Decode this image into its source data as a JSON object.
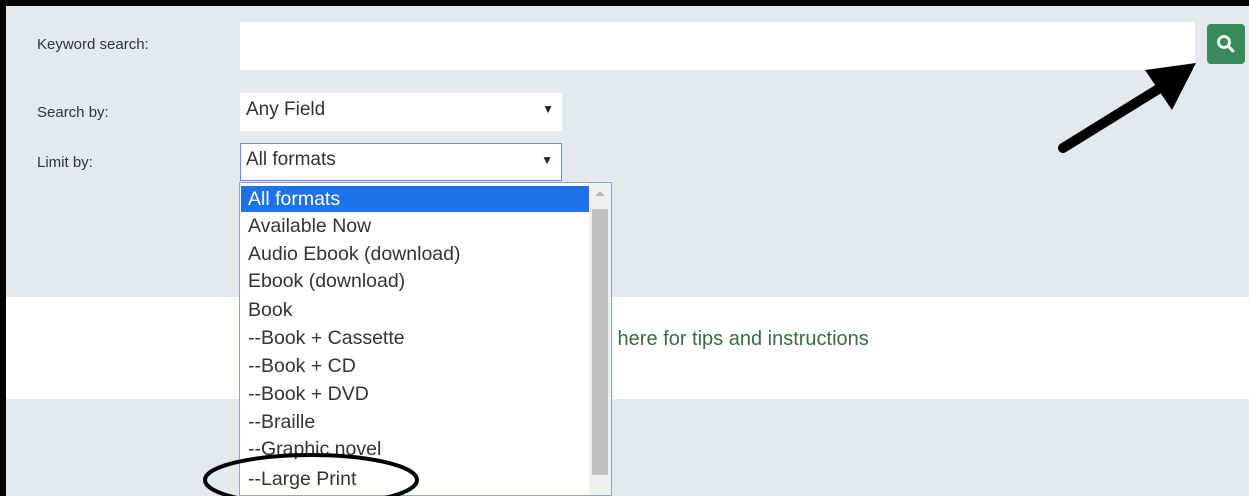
{
  "form": {
    "keyword_label": "Keyword search:",
    "keyword_value": "",
    "search_by_label": "Search by:",
    "search_by_value": "Any Field",
    "limit_by_label": "Limit by:",
    "limit_by_value": "All formats"
  },
  "search_button": {
    "icon": "search-icon"
  },
  "tips_link": "ck here for tips and instructions",
  "format_options": [
    "All formats",
    "Available Now",
    "Audio Ebook (download)",
    "Ebook (download)",
    "Book",
    "--Book + Cassette",
    "--Book + CD",
    "--Book + DVD",
    "--Braille",
    "--Graphic novel",
    "--Large Print"
  ],
  "selected_option": "All formats",
  "colors": {
    "panel": "#e5e8ec",
    "search_button": "#3a8a5c",
    "selection": "#1e73e8",
    "link": "#3a6a47"
  },
  "annotations": {
    "arrow": "pointing-to-search-button",
    "ellipse": "circling-large-print-option"
  }
}
